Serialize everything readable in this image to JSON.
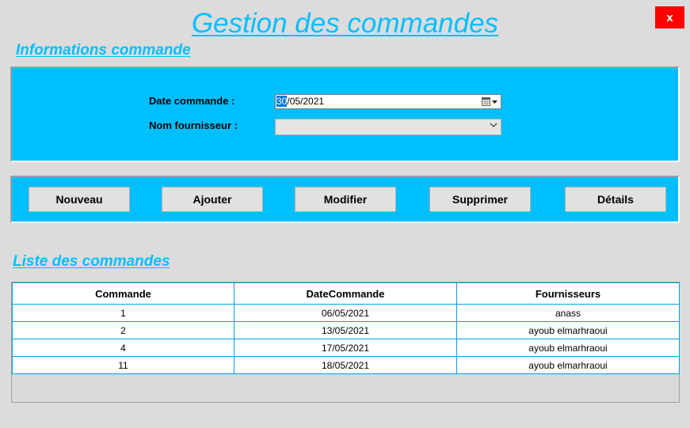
{
  "window": {
    "title": "Gestion des commandes",
    "close_label": "x"
  },
  "info_section": {
    "title": "Informations commande",
    "date_label": "Date commande  :",
    "date_selected_part": "30",
    "date_rest": "/05/2021",
    "supplier_label": "Nom fournisseur :",
    "supplier_value": ""
  },
  "actions": {
    "new_label": "Nouveau",
    "add_label": "Ajouter",
    "edit_label": "Modifier",
    "delete_label": "Supprimer",
    "details_label": "Détails"
  },
  "list_section": {
    "title": "Liste des commandes",
    "columns": [
      "Commande",
      "DateCommande",
      "Fournisseurs"
    ],
    "rows": [
      [
        "1",
        "06/05/2021",
        "anass"
      ],
      [
        "2",
        "13/05/2021",
        "ayoub elmarhraoui"
      ],
      [
        "4",
        "17/05/2021",
        "ayoub elmarhraoui"
      ],
      [
        "11",
        "18/05/2021",
        "ayoub elmarhraoui"
      ]
    ]
  },
  "colors": {
    "accent": "#00bfff",
    "close_button": "#ff0000",
    "grid_lines": "#00a2e8",
    "background": "#dcdcdc"
  },
  "icons": {
    "date_picker": "calendar-icon",
    "date_dropdown": "dropdown-arrow-icon",
    "combo_dropdown": "chevron-down-icon"
  }
}
